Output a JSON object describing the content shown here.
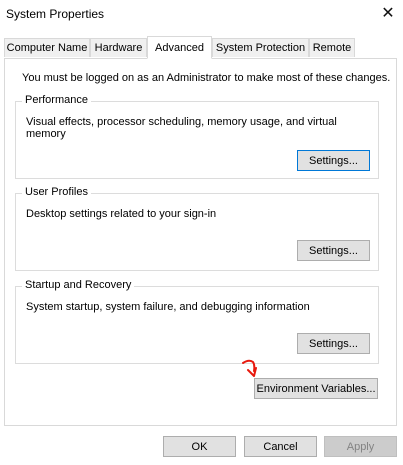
{
  "window": {
    "title": "System Properties",
    "close_glyph": "✕"
  },
  "tabs": [
    {
      "label": "Computer Name"
    },
    {
      "label": "Hardware"
    },
    {
      "label": "Advanced",
      "active": true
    },
    {
      "label": "System Protection"
    },
    {
      "label": "Remote"
    }
  ],
  "advanced": {
    "intro": "You must be logged on as an Administrator to make most of these changes.",
    "performance": {
      "title": "Performance",
      "description": "Visual effects, processor scheduling, memory usage, and virtual memory",
      "button": "Settings..."
    },
    "user_profiles": {
      "title": "User Profiles",
      "description": "Desktop settings related to your sign-in",
      "button": "Settings..."
    },
    "startup_recovery": {
      "title": "Startup and Recovery",
      "description": "System startup, system failure, and debugging information",
      "button": "Settings..."
    },
    "env_button": "Environment Variables..."
  },
  "footer": {
    "ok": "OK",
    "cancel": "Cancel",
    "apply": "Apply"
  },
  "annotation": {
    "color": "#e8190e",
    "icon": "red-arrow-icon"
  }
}
